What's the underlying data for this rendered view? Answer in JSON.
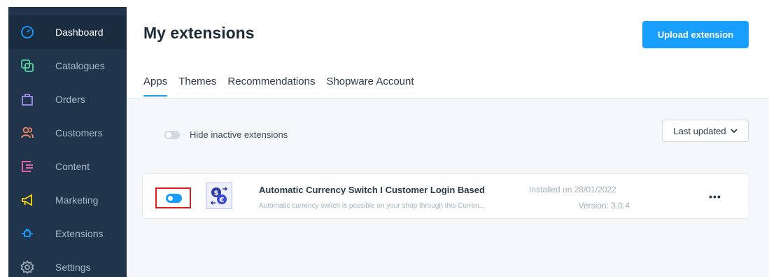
{
  "sidebar": {
    "items": [
      {
        "label": "Dashboard",
        "icon": "dashboard-icon",
        "color": "#189eff",
        "active": true
      },
      {
        "label": "Catalogues",
        "icon": "catalogues-icon",
        "color": "#57d9a3"
      },
      {
        "label": "Orders",
        "icon": "orders-icon",
        "color": "#a092f0"
      },
      {
        "label": "Customers",
        "icon": "customers-icon",
        "color": "#f88962"
      },
      {
        "label": "Content",
        "icon": "content-icon",
        "color": "#ff68b4"
      },
      {
        "label": "Marketing",
        "icon": "marketing-icon",
        "color": "#ffd700"
      },
      {
        "label": "Extensions",
        "icon": "extensions-icon",
        "color": "#189eff"
      },
      {
        "label": "Settings",
        "icon": "settings-icon",
        "color": "#9aa8b5"
      }
    ]
  },
  "header": {
    "title": "My extensions",
    "upload_label": "Upload extension"
  },
  "tabs": [
    {
      "label": "Apps",
      "active": true
    },
    {
      "label": "Themes"
    },
    {
      "label": "Recommendations"
    },
    {
      "label": "Shopware Account"
    }
  ],
  "filters": {
    "hide_inactive_label": "Hide inactive extensions",
    "sort_label": "Last updated"
  },
  "extension": {
    "name": "Automatic Currency Switch I Customer Login Based",
    "description": "Automatic currency switch is possible on your shop through this Curren...",
    "installed": "Installed on 28/01/2022",
    "version": "Version: 3.0.4",
    "active": true
  },
  "colors": {
    "accent": "#189eff",
    "sidebar_bg": "#20354b",
    "highlight": "#e31b1b"
  }
}
